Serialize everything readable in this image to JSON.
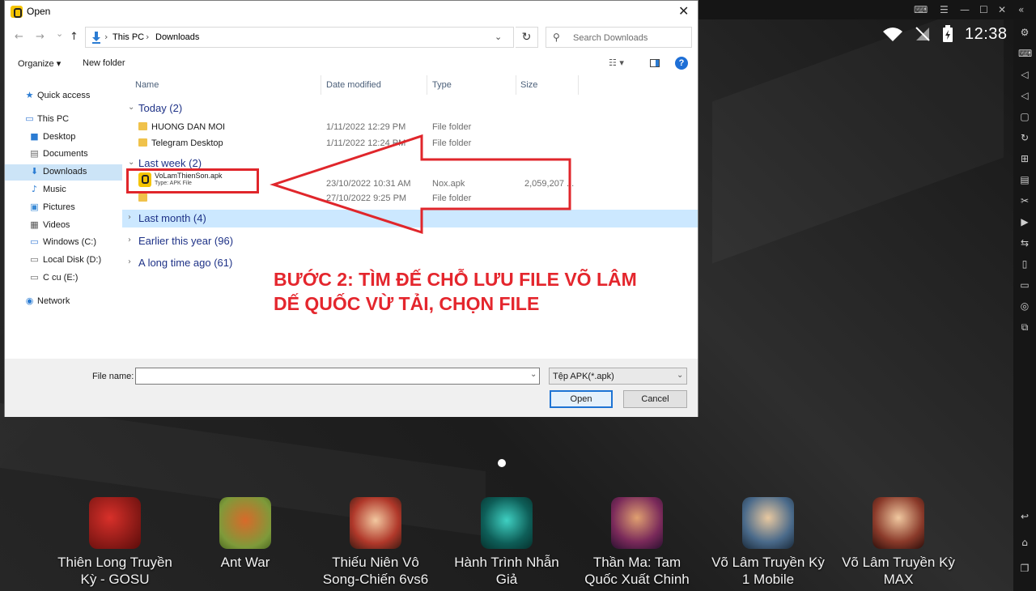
{
  "dialog": {
    "title": "Open",
    "nav": {
      "back": "←",
      "forward": "→",
      "recent": "⌄",
      "up": "↑"
    },
    "address": {
      "this_pc": "This PC",
      "sep": "›",
      "current": "Downloads",
      "dropdown": "⌄"
    },
    "refresh": "↻",
    "search_placeholder": "Search Downloads",
    "search_icon": "⚲",
    "toolbar": {
      "organize": "Organize ▾",
      "new_folder": "New folder",
      "view_menu": "☷ ▾",
      "help": "?"
    },
    "sidebar": [
      {
        "label": "Quick access",
        "icon": "star-icon",
        "glyph": "★"
      },
      {
        "label": "This PC",
        "icon": "computer-icon",
        "glyph": "▭"
      },
      {
        "label": "Desktop",
        "icon": "desktop-icon",
        "glyph": "■"
      },
      {
        "label": "Documents",
        "icon": "documents-icon",
        "glyph": "▤"
      },
      {
        "label": "Downloads",
        "icon": "download-icon",
        "glyph": "⬇"
      },
      {
        "label": "Music",
        "icon": "music-icon",
        "glyph": "♪"
      },
      {
        "label": "Pictures",
        "icon": "pictures-icon",
        "glyph": "▣"
      },
      {
        "label": "Videos",
        "icon": "videos-icon",
        "glyph": "▦"
      },
      {
        "label": "Windows (C:)",
        "icon": "drive-icon",
        "glyph": "▭"
      },
      {
        "label": "Local Disk (D:)",
        "icon": "drive-icon",
        "glyph": "▭"
      },
      {
        "label": "C cu (E:)",
        "icon": "drive-icon",
        "glyph": "▭"
      },
      {
        "label": "Network",
        "icon": "network-icon",
        "glyph": "◉"
      }
    ],
    "columns": {
      "name": "Name",
      "date": "Date modified",
      "type": "Type",
      "size": "Size"
    },
    "groups": {
      "today": "Today (2)",
      "last_week": "Last week (2)",
      "last_month": "Last month (4)",
      "earlier_year": "Earlier this year (96)",
      "long_ago": "A long time ago (61)"
    },
    "files": {
      "huong": {
        "name": "HUONG DAN MOI",
        "date": "1/11/2022 12:29 PM",
        "type": "File folder"
      },
      "telegram": {
        "name": "Telegram Desktop",
        "date": "1/11/2022 12:24 PM",
        "type": "File folder"
      },
      "apk": {
        "name": "VoLamThienSon.apk",
        "sub": "Type: APK File",
        "date": "23/10/2022 10:31 AM",
        "type": "Nox.apk",
        "size": "2,059,207 ..."
      },
      "folder2": {
        "date": "27/10/2022 9:25 PM",
        "type": "File folder"
      }
    },
    "caption_line1": "BƯỚC 2: TÌM ĐẾ CHỖ LƯU FILE VÕ LÂM",
    "caption_line2": "DẾ QUỐC VỪ TẢI, CHỌN FILE",
    "filename_label": "File name:",
    "filename_value": "",
    "filetype": "Tệp APK(*.apk)",
    "open_button": "Open",
    "cancel_button": "Cancel"
  },
  "emulator": {
    "clock": "12:38",
    "apps": [
      {
        "label_l1": "Thiên Long Truyền",
        "label_l2": "Kỳ - GOSU"
      },
      {
        "label_l1": "Ant War",
        "label_l2": ""
      },
      {
        "label_l1": "Thiếu Niên Vô",
        "label_l2": "Song-Chiến 6vs6"
      },
      {
        "label_l1": "Hành Trình Nhẫn",
        "label_l2": "Giả"
      },
      {
        "label_l1": "Thần Ma: Tam",
        "label_l2": "Quốc Xuất Chinh"
      },
      {
        "label_l1": "Võ Lâm Truyền Kỳ",
        "label_l2": "1 Mobile"
      },
      {
        "label_l1": "Võ Lâm Truyền Kỳ",
        "label_l2": "MAX"
      }
    ],
    "colors": {
      "highlight_red": "#e4262d",
      "accent_blue": "#1e74d4"
    }
  }
}
